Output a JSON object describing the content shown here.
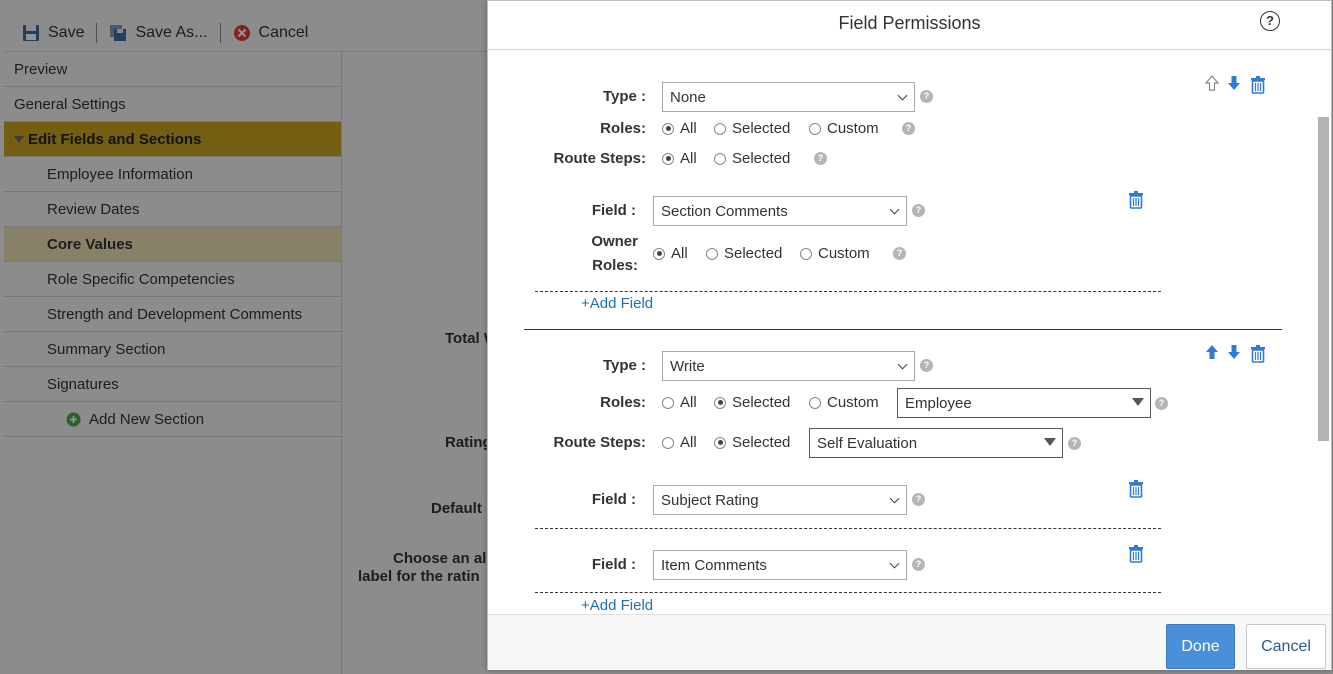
{
  "toolbar": {
    "save": "Save",
    "save_as": "Save As...",
    "cancel": "Cancel"
  },
  "sidebar": {
    "items": [
      {
        "label": "Preview"
      },
      {
        "label": "General Settings"
      },
      {
        "label": "Edit Fields and Sections"
      },
      {
        "label": "Employee Information"
      },
      {
        "label": "Review Dates"
      },
      {
        "label": "Core Values"
      },
      {
        "label": "Role Specific Competencies"
      },
      {
        "label": "Strength and Development Comments"
      },
      {
        "label": "Summary Section"
      },
      {
        "label": "Signatures"
      }
    ],
    "add_new_section": "Add New Section"
  },
  "background_labels": {
    "total": "Total W",
    "rating": "Rating",
    "default": "Default",
    "choose_1": "Choose an al",
    "choose_2": "label for the ratin"
  },
  "dialog": {
    "title": "Field Permissions",
    "help": "?",
    "labels": {
      "type": "Type :",
      "roles": "Roles:",
      "route_steps": "Route Steps:",
      "field": "Field :",
      "owner_1": "Owner",
      "owner_2": "Roles:"
    },
    "options": {
      "all": "All",
      "selected": "Selected",
      "custom": "Custom"
    },
    "add_field": "+Add Field",
    "block1": {
      "type": "None",
      "field": "Section Comments"
    },
    "block2": {
      "type": "Write",
      "roles_value": "Employee",
      "route_value": "Self Evaluation",
      "field1": "Subject Rating",
      "field2": "Item Comments"
    },
    "done": "Done",
    "cancel": "Cancel"
  },
  "colors": {
    "accent": "#c7a21e",
    "primary_button": "#4a90d9",
    "link": "#1f6fb5"
  }
}
